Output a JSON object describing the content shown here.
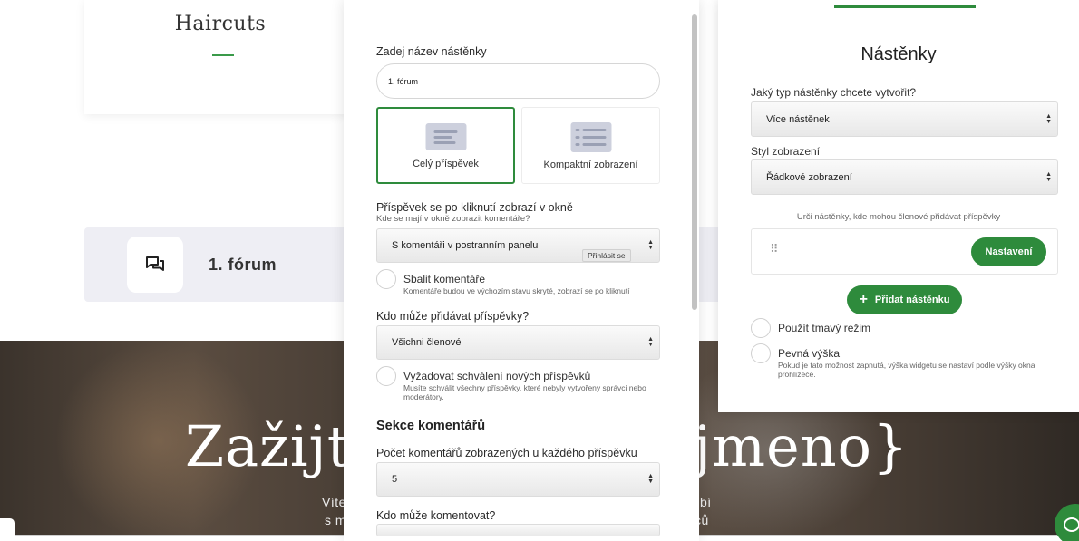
{
  "background": {
    "haircuts_title": "Haircuts",
    "forum_label": "1. fórum",
    "hero_title_left": "Zažijte",
    "hero_title_right": "jmeno}",
    "hero_text_left_1": "Vítej",
    "hero_text_left_2": "s m",
    "hero_text_right_1": "bí",
    "hero_text_right_2": "ců"
  },
  "settings": {
    "name_label": "Zadej název nástěnky",
    "name_value": "1. fórum",
    "layout_options": [
      {
        "label": "Celý příspěvek",
        "selected": true
      },
      {
        "label": "Kompaktní zobrazení",
        "selected": false
      }
    ],
    "post_click_label": "Příspěvek se po kliknutí zobrazí v okně",
    "post_click_sub": "Kde se mají v okně zobrazit komentáře?",
    "post_click_value": "S komentáři v postranním panelu",
    "login_chip": "Přihlásit se",
    "collapse_title": "Sbalit komentáře",
    "collapse_desc": "Komentáře budou ve výchozím stavu skryté, zobrazí se po kliknutí",
    "who_posts_label": "Kdo může přidávat příspěvky?",
    "who_posts_value": "Všichni členové",
    "approval_title": "Vyžadovat schválení nových příspěvků",
    "approval_desc": "Musíte schválit všechny příspěvky, které nebyly vytvořeny správci nebo moderátory.",
    "comments_section": "Sekce komentářů",
    "comments_count_label": "Počet komentářů zobrazených u každého příspěvku",
    "comments_count_value": "5",
    "who_comments_label": "Kdo může komentovat?"
  },
  "boards": {
    "title": "Nástěnky",
    "type_label": "Jaký typ nástěnky chcete vytvořit?",
    "type_value": "Více nástěnek",
    "style_label": "Styl zobrazení",
    "style_value": "Řádkové zobrazení",
    "hint": "Urči nástěnky, kde mohou členové přidávat příspěvky",
    "settings_button": "Nastavení",
    "add_button": "Přidat nástěnku",
    "dark_mode_label": "Použít tmavý režim",
    "fixed_height_label": "Pevná výška",
    "fixed_height_desc": "Pokud je tato možnost zapnutá, výška widgetu se nastaví podle výšky okna prohlížeče."
  },
  "colors": {
    "accent_green": "#2e8b3c",
    "placeholder_icon": "#cdd0dd"
  }
}
